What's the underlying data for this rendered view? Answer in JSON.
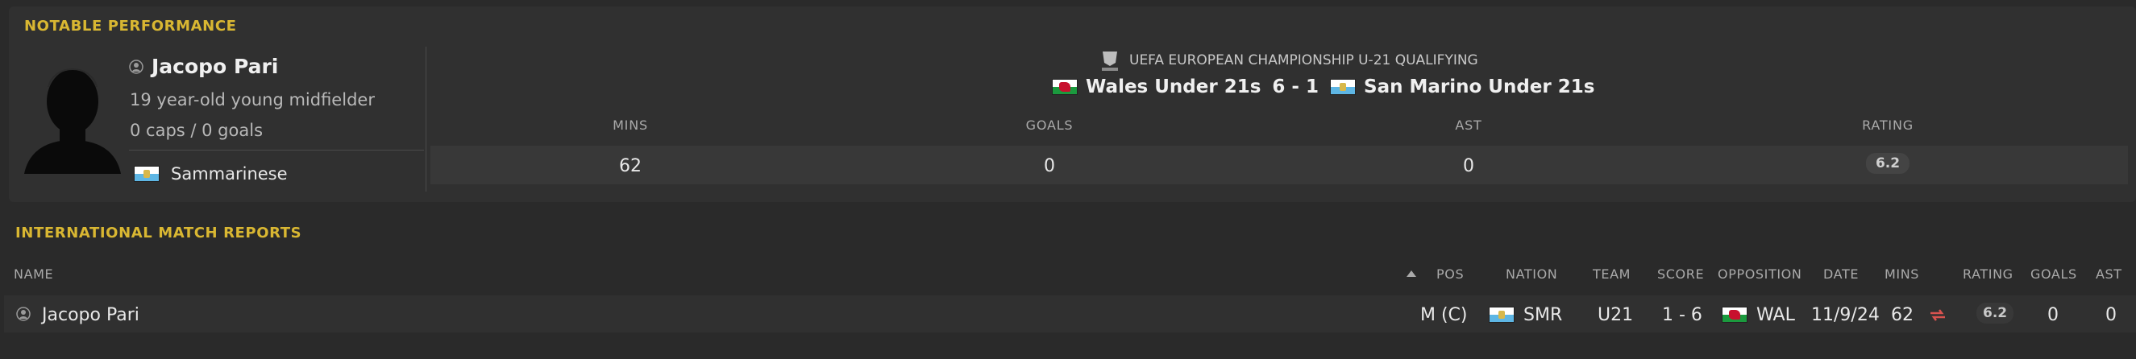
{
  "notable": {
    "section_title": "NOTABLE PERFORMANCE",
    "player": {
      "name": "Jacopo Pari",
      "description": "19 year-old young midfielder",
      "caps": "0 caps / 0 goals",
      "nationality": "Sammarinese"
    },
    "competition": "UEFA EUROPEAN CHAMPIONSHIP U-21 QUALIFYING",
    "match": {
      "home_team": "Wales Under 21s",
      "score": "6 - 1",
      "away_team": "San Marino Under 21s"
    },
    "stats": {
      "headers": [
        "MINS",
        "GOALS",
        "AST",
        "RATING"
      ],
      "values": [
        "62",
        "0",
        "0",
        "6.2"
      ]
    }
  },
  "reports": {
    "section_title": "INTERNATIONAL MATCH REPORTS",
    "columns": {
      "name": "NAME",
      "pos": "POS",
      "nation": "NATION",
      "team": "TEAM",
      "score": "SCORE",
      "opposition": "OPPOSITION",
      "date": "DATE",
      "mins": "MINS",
      "rating": "RATING",
      "goals": "GOALS",
      "ast": "AST"
    },
    "rows": [
      {
        "name": "Jacopo Pari",
        "pos": "M (C)",
        "nation": "SMR",
        "team": "U21",
        "score": "1 - 6",
        "opposition": "WAL",
        "date": "11/9/24",
        "mins": "62",
        "rating": "6.2",
        "goals": "0",
        "ast": "0"
      }
    ]
  },
  "colors": {
    "accent_title": "#d9b732",
    "background": "#2a2a2a",
    "panel": "#303030",
    "sub_icon": "#d9534f"
  },
  "icons": [
    "person-icon",
    "uefa-logo-icon",
    "wales-flag-icon",
    "san-marino-flag-icon",
    "sort-ascending-icon",
    "substitution-icon",
    "player-silhouette"
  ]
}
